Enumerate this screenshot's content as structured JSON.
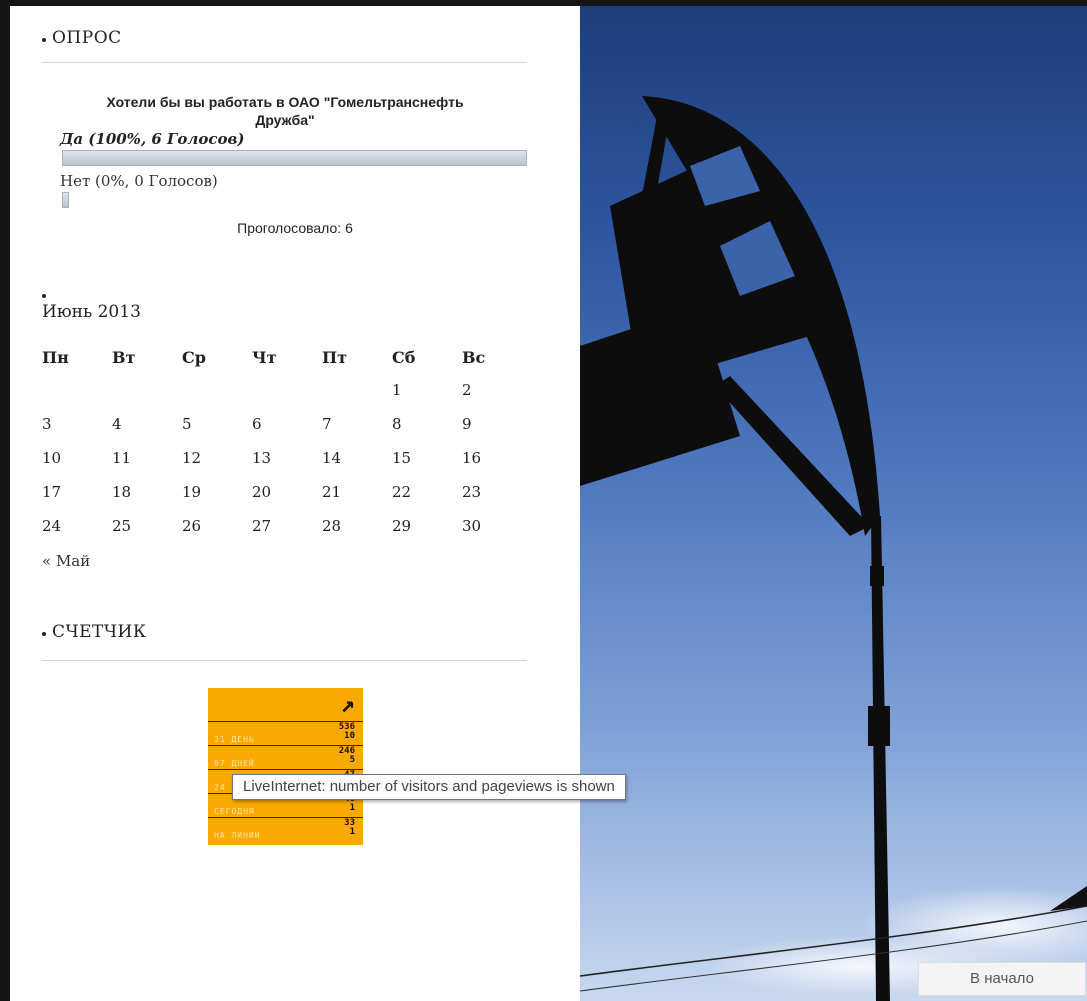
{
  "poll": {
    "title": "ОПРОС",
    "question": "Хотели бы вы работать в ОАО \"Гомельтранснефть Дружба\"",
    "answers": [
      {
        "label": "Да (100%, 6 Голосов)",
        "percent": 100
      },
      {
        "label": "Нет (0%, 0 Голосов)",
        "percent": 0
      }
    ],
    "total": "Проголосовало: 6"
  },
  "calendar": {
    "month": "Июнь 2013",
    "weekdays": [
      "Пн",
      "Вт",
      "Ср",
      "Чт",
      "Пт",
      "Сб",
      "Вс"
    ],
    "weeks": [
      [
        "",
        "",
        "",
        "",
        "",
        "1",
        "2"
      ],
      [
        "3",
        "4",
        "5",
        "6",
        "7",
        "8",
        "9"
      ],
      [
        "10",
        "11",
        "12",
        "13",
        "14",
        "15",
        "16"
      ],
      [
        "17",
        "18",
        "19",
        "20",
        "21",
        "22",
        "23"
      ],
      [
        "24",
        "25",
        "26",
        "27",
        "28",
        "29",
        "30"
      ]
    ],
    "prev": "« Май"
  },
  "counter": {
    "title": "СЧЕТЧИК",
    "rows": [
      {
        "label": "31 ДЕНЬ",
        "v1": "536",
        "v2": "10"
      },
      {
        "label": "07 ДНЕЙ",
        "v1": "246",
        "v2": "5"
      },
      {
        "label": "24 ЧАСА",
        "v1": "47",
        "v2": "1"
      },
      {
        "label": "СЕГОДНЯ",
        "v1": "40",
        "v2": "1"
      },
      {
        "label": "НА ЛИНИИ",
        "v1": "33",
        "v2": "1"
      }
    ],
    "tooltip": "LiveInternet: number of visitors and pageviews is shown"
  },
  "to_top": "В начало",
  "colors": {
    "counter_bg": "#fba800",
    "sky_top": "#1e3e7a",
    "sky_bottom": "#c8d8ee"
  },
  "icons": {
    "counter_arrow": "arrow-up-right-icon"
  }
}
